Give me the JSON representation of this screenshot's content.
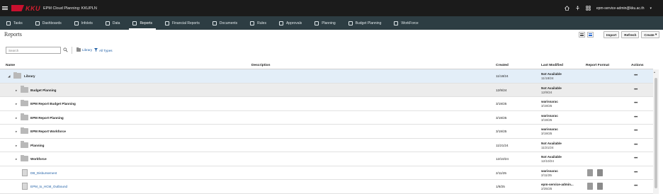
{
  "header": {
    "logo_text": "KKU",
    "app_title": "EPM Cloud Planning: KKUPLN",
    "user": "epm-service-admin@kku.ac.th",
    "icons": [
      "home-icon",
      "accessibility-icon",
      "apps-icon"
    ]
  },
  "nav": {
    "items": [
      {
        "label": "Tasks",
        "icon": "tasks-icon"
      },
      {
        "label": "Dashboards",
        "icon": "dashboards-icon"
      },
      {
        "label": "Infolets",
        "icon": "infolets-icon"
      },
      {
        "label": "Data",
        "icon": "data-icon"
      },
      {
        "label": "Reports",
        "icon": "reports-icon"
      },
      {
        "label": "Financial Reports",
        "icon": "financial-reports-icon"
      },
      {
        "label": "Documents",
        "icon": "documents-icon"
      },
      {
        "label": "Rules",
        "icon": "rules-icon"
      },
      {
        "label": "Approvals",
        "icon": "approvals-icon"
      },
      {
        "label": "Planning",
        "icon": "planning-icon"
      },
      {
        "label": "Budget Planning",
        "icon": "budget-planning-icon"
      },
      {
        "label": "WorkForce",
        "icon": "workforce-icon"
      }
    ],
    "active": "Reports"
  },
  "page": {
    "title": "Reports",
    "import_label": "Import",
    "refresh_label": "Refresh",
    "create_label": "Create"
  },
  "filters": {
    "search_placeholder": "Search",
    "library_label": "Library",
    "types_label": "All Types"
  },
  "table": {
    "columns": {
      "name": "Name",
      "description": "Description",
      "created": "Created",
      "last_modified": "Last Modified",
      "report_format": "Report Format",
      "actions": "Actions"
    },
    "rows": [
      {
        "name": "Library",
        "type": "folder",
        "level": 0,
        "expanded": true,
        "created": "11/18/24",
        "modified_by": "Not Available",
        "modified_on": "11/18/24",
        "formats": false
      },
      {
        "name": "Budget Planning",
        "type": "folder",
        "level": 1,
        "expanded": false,
        "created": "12/9/24",
        "modified_by": "Not Available",
        "modified_on": "12/9/24",
        "formats": false
      },
      {
        "name": "EPM Report Budget Planning",
        "type": "folder",
        "level": 1,
        "expanded": false,
        "created": "3/19/25",
        "modified_by": "warissarac",
        "modified_on": "3/19/25",
        "formats": false
      },
      {
        "name": "EPM Report Planning",
        "type": "folder",
        "level": 1,
        "expanded": false,
        "created": "3/19/25",
        "modified_by": "warissarac",
        "modified_on": "3/19/25",
        "formats": false
      },
      {
        "name": "EPM Report Workforce",
        "type": "folder",
        "level": 1,
        "expanded": false,
        "created": "3/19/25",
        "modified_by": "warissarac",
        "modified_on": "3/19/25",
        "formats": false
      },
      {
        "name": "Planning",
        "type": "folder",
        "level": 1,
        "expanded": false,
        "created": "11/21/24",
        "modified_by": "Not Available",
        "modified_on": "11/21/24",
        "formats": false
      },
      {
        "name": "Workforce",
        "type": "folder",
        "level": 1,
        "expanded": false,
        "created": "12/10/24",
        "modified_by": "Not Available",
        "modified_on": "12/10/24",
        "formats": false
      },
      {
        "name": "DB_Disbursement",
        "type": "report",
        "level": 1,
        "created": "2/11/25",
        "modified_by": "warissarac",
        "modified_on": "2/11/25",
        "formats": true
      },
      {
        "name": "EPM_to_HCM_Outbound",
        "type": "report",
        "level": 1,
        "created": "1/8/25",
        "modified_by": "epm-service-admin...",
        "modified_on": "2/25/25",
        "formats": true
      }
    ],
    "actions_glyph": "•••"
  }
}
